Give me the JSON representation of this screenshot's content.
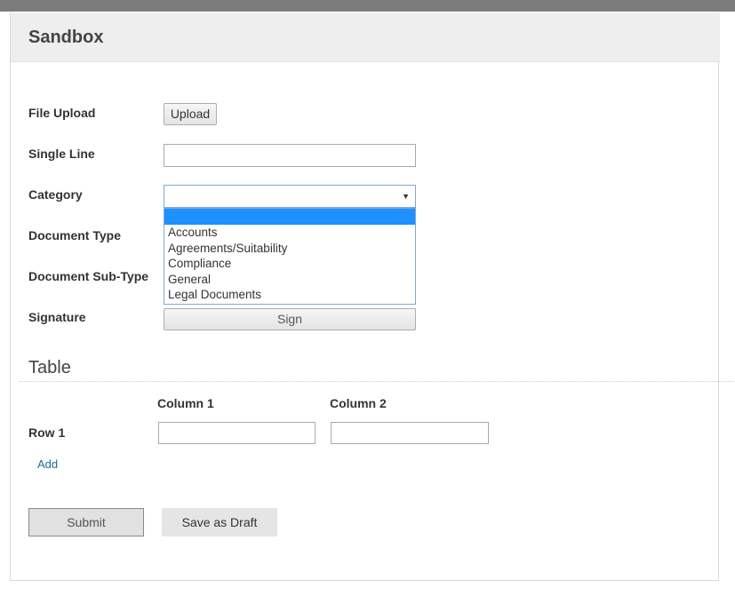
{
  "header": {
    "title": "Sandbox"
  },
  "form": {
    "file_upload": {
      "label": "File Upload",
      "button_label": "Upload"
    },
    "single_line": {
      "label": "Single Line",
      "value": ""
    },
    "category": {
      "label": "Category",
      "selected_value": "",
      "options": [
        "",
        "Accounts",
        "Agreements/Suitability",
        "Compliance",
        "General",
        "Legal Documents"
      ]
    },
    "document_type": {
      "label": "Document Type"
    },
    "document_sub_type": {
      "label": "Document Sub-Type"
    },
    "signature": {
      "label": "Signature",
      "button_label": "Sign"
    }
  },
  "table_section": {
    "title": "Table",
    "columns": [
      "Column 1",
      "Column 2"
    ],
    "rows": [
      {
        "label": "Row 1",
        "values": [
          "",
          ""
        ]
      }
    ],
    "add_label": "Add"
  },
  "actions": {
    "submit_label": "Submit",
    "draft_label": "Save as Draft"
  },
  "colors": {
    "topbar": "#7b7b7b",
    "header_bg": "#eeeeee",
    "selected_option": "#1e90ff",
    "link": "#1a6f96"
  },
  "icons": {
    "select_arrow": "triangle-down-icon"
  }
}
